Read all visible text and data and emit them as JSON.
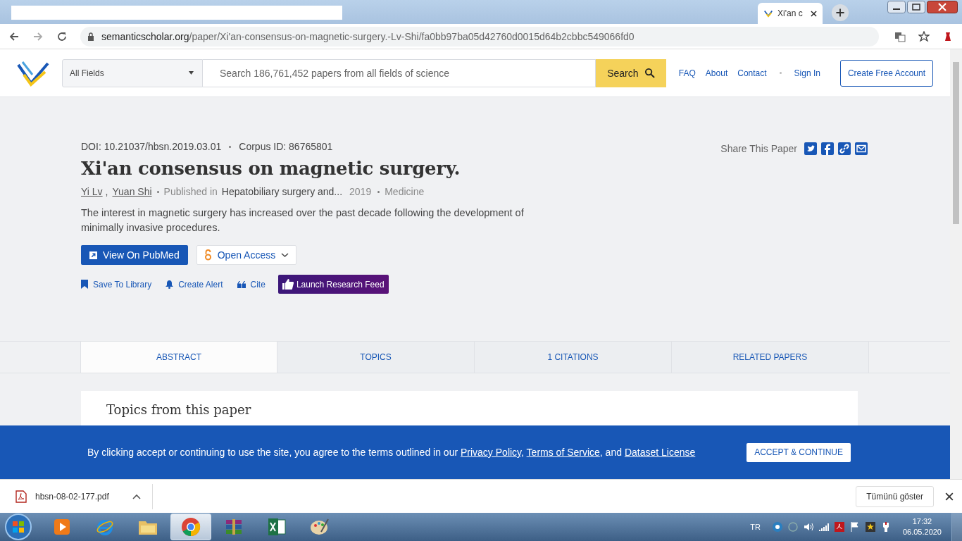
{
  "browser": {
    "tab_title": "Xi'an c",
    "url_domain": "semanticscholar.org",
    "url_path": "/paper/Xi'an-consensus-on-magnetic-surgery.-Lv-Shi/fa0bb97ba05d42760d0015d64b2cbbc549066fd0"
  },
  "header": {
    "field_select": "All Fields",
    "search_placeholder": "Search 186,761,452 papers from all fields of science",
    "search_button": "Search",
    "links": [
      "FAQ",
      "About",
      "Contact"
    ],
    "sign_in": "Sign In",
    "create_account": "Create Free Account"
  },
  "paper": {
    "doi": "DOI: 10.21037/hbsn.2019.03.01",
    "corpus_id": "Corpus ID: 86765801",
    "title": "Xi'an consensus on magnetic surgery.",
    "authors": [
      "Yi Lv",
      "Yuan Shi"
    ],
    "author_separator": ",",
    "published_label": "Published in",
    "venue": "Hepatobiliary surgery and...",
    "year": "2019",
    "field": "Medicine",
    "abstract": "The interest in magnetic surgery has increased over the past decade following the development of minimally invasive procedures.",
    "pubmed_button": "View On PubMed",
    "open_access": "Open Access",
    "actions": [
      {
        "kind": "bookmark",
        "label": "Save To Library"
      },
      {
        "kind": "bell",
        "label": "Create Alert"
      },
      {
        "kind": "quote",
        "label": "Cite"
      }
    ],
    "research_feed": "Launch Research Feed",
    "share_label": "Share This Paper"
  },
  "tabs": [
    {
      "label": "ABSTRACT",
      "selected": true
    },
    {
      "label": "TOPICS",
      "selected": false
    },
    {
      "label": "1 CITATIONS",
      "selected": false
    },
    {
      "label": "RELATED PAPERS",
      "selected": false
    }
  ],
  "card_heading": "Topics from this paper",
  "cookie": {
    "text": "By clicking accept or continuing to use the site, you agree to the terms outlined in our ",
    "links": [
      "Privacy Policy",
      "Terms of Service",
      "Dataset License"
    ],
    "separators": [
      ", ",
      ", and "
    ],
    "button": "ACCEPT & CONTINUE"
  },
  "downloads": {
    "file": "hbsn-08-02-177.pdf",
    "show_all": "Tümünü göster"
  },
  "taskbar": {
    "apps": [
      {
        "kind": "media",
        "selected": false
      },
      {
        "kind": "ie",
        "selected": false
      },
      {
        "kind": "folder",
        "selected": false
      },
      {
        "kind": "chrome",
        "selected": true
      },
      {
        "kind": "archive",
        "selected": false
      },
      {
        "kind": "excel",
        "selected": false
      },
      {
        "kind": "paint",
        "selected": false
      }
    ],
    "language": "TR",
    "time": "17:32",
    "date": "06.05.2020"
  }
}
